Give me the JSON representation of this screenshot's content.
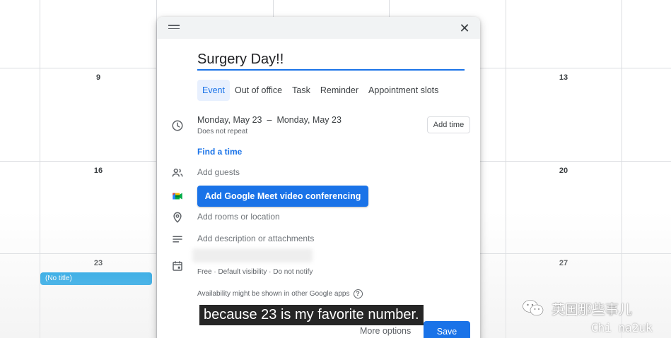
{
  "calendar": {
    "day_numbers": [
      "9",
      "13",
      "16",
      "20",
      "23",
      "27"
    ],
    "event_chip": "(No title)",
    "colors": {
      "grid": "#dadce0",
      "chip": "#039be5"
    }
  },
  "dialog": {
    "title_value": "Surgery Day!!",
    "tabs": [
      {
        "label": "Event",
        "active": true
      },
      {
        "label": "Out of office",
        "active": false
      },
      {
        "label": "Task",
        "active": false
      },
      {
        "label": "Reminder",
        "active": false
      },
      {
        "label": "Appointment slots",
        "active": false
      }
    ],
    "date": {
      "start": "Monday, May 23",
      "separator": "–",
      "end": "Monday, May 23",
      "repeat": "Does not repeat",
      "add_time_label": "Add time"
    },
    "find_time_label": "Find a time",
    "add_guests_placeholder": "Add guests",
    "meet_button_label": "Add Google Meet video conferencing",
    "location_placeholder": "Add rooms or location",
    "description_placeholder": "Add description or attachments",
    "calendar_settings": "Free · Default visibility · Do not notify",
    "availability_note": "Availability might be shown in other Google apps",
    "more_options_label": "More options",
    "save_label": "Save",
    "close_glyph": "✕",
    "icons": [
      "drag-handle-icon",
      "close-icon",
      "clock-icon",
      "people-icon",
      "google-meet-icon",
      "location-pin-icon",
      "description-icon",
      "calendar-icon",
      "help-icon"
    ],
    "colors": {
      "primary": "#1a73e8",
      "header": "#f1f3f4",
      "active_tab_bg": "#e8f0fe"
    }
  },
  "overlay": {
    "subtitle": "because 23 is my favorite number.",
    "watermark_title": "英国那些事儿",
    "watermark_sub": "Chi na2uk"
  }
}
